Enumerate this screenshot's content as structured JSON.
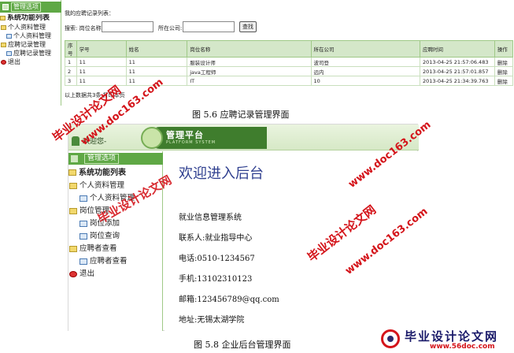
{
  "fig1": {
    "menu_tab": "管理选项",
    "tree_title": "系统功能列表",
    "tree": [
      {
        "label": "个人资料管理",
        "kind": "folder",
        "indent": 0
      },
      {
        "label": "个人资料管理",
        "kind": "page",
        "indent": 1
      },
      {
        "label": "应聘记录管理",
        "kind": "folder",
        "indent": 0
      },
      {
        "label": "应聘记录管理",
        "kind": "page",
        "indent": 1
      },
      {
        "label": "退出",
        "kind": "exit",
        "indent": 0
      }
    ],
    "list_title": "我的应聘记录列表：",
    "search": {
      "label1": "搜索: 岗位名称:",
      "label2": "所在公司:",
      "button": "查找"
    },
    "table": {
      "headers": [
        "序号",
        "学号",
        "姓名",
        "岗位名称",
        "所在公司",
        "应聘时间",
        "操作"
      ],
      "rows": [
        [
          "1",
          "11",
          "11",
          "服装设计师",
          "波司登",
          "2013-04-25 21:57:06.483",
          "删除"
        ],
        [
          "2",
          "11",
          "11",
          "java工程师",
          "远内",
          "2013-04-25 21:57:01.857",
          "删除"
        ],
        [
          "3",
          "11",
          "11",
          "IT",
          "10",
          "2013-04-25 21:34:39.763",
          "删除"
        ]
      ]
    },
    "footer": "以上数据共3条,打印本页"
  },
  "caption1": "图 5.6  应聘记录管理界面",
  "fig2": {
    "welcome": "欢迎您-",
    "brand_title": "管理平台",
    "brand_sub": "PLATFORM SYSTEM",
    "menu_tab": "管理选项",
    "tree_title": "系统功能列表",
    "tree": [
      {
        "label": "个人资料管理",
        "kind": "folder",
        "indent": 0
      },
      {
        "label": "个人资料管理",
        "kind": "page",
        "indent": 1
      },
      {
        "label": "岗位管理",
        "kind": "folder",
        "indent": 0
      },
      {
        "label": "岗位添加",
        "kind": "page",
        "indent": 1
      },
      {
        "label": "岗位查询",
        "kind": "page",
        "indent": 1
      },
      {
        "label": "应聘者查看",
        "kind": "folder",
        "indent": 0
      },
      {
        "label": "应聘者查看",
        "kind": "page",
        "indent": 1
      },
      {
        "label": "退出",
        "kind": "exit",
        "indent": 0
      }
    ],
    "heading": "欢迎进入后台",
    "info": [
      "就业信息管理系统",
      "联系人:就业指导中心",
      "电话:0510-1234567",
      "手机:13102310123",
      "邮箱:123456789@qq.com",
      "地址:无锡太湖学院"
    ]
  },
  "caption2": "图 5.8  企业后台管理界面",
  "watermarks": [
    "毕业设计论文网",
    "www.doc163.com",
    "毕业设计论文网",
    "www.doc163.com",
    "毕业设计论文网",
    "www.doc163.com"
  ],
  "logo": {
    "name": "毕业设计论文网",
    "url": "www.56doc.com"
  },
  "colors": {
    "green_bar": "#5fa845",
    "watermark": "#d4141a",
    "heading": "#2f3f8f"
  }
}
